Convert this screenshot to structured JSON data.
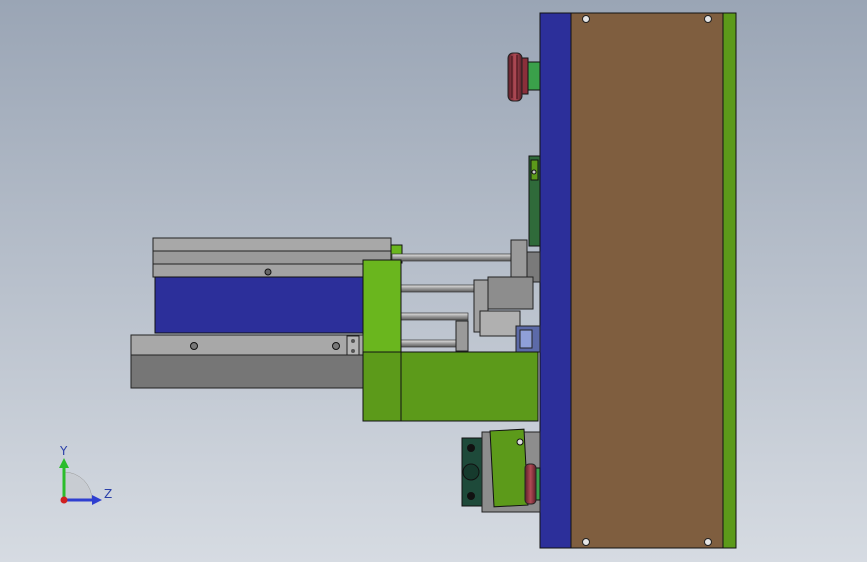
{
  "view": {
    "background_top": "#9aa5b5",
    "background_bottom": "#d6dbe2"
  },
  "triad": {
    "y_label": "Y",
    "z_label": "Z",
    "y_color": "#2bbd2b",
    "z_color": "#2f3fd0",
    "x_color": "#d02020"
  },
  "colors": {
    "navy": "#2c2f9a",
    "brown": "#7f5e3f",
    "green": "#5c9a1a",
    "lime": "#6ab61e",
    "gray": "#8d8d8d",
    "gray_light": "#a8a8a8",
    "maroon": "#8a2f3a",
    "dark_green": "#1e4a3a"
  }
}
